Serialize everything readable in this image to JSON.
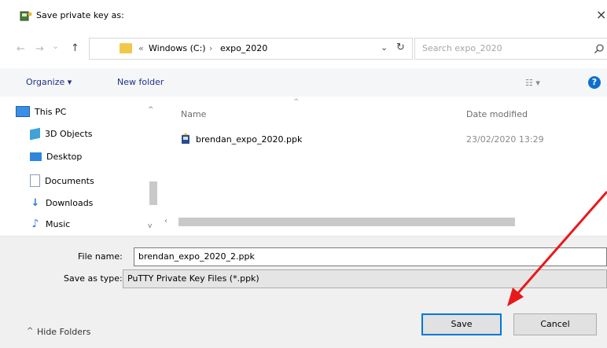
{
  "window": {
    "title": "Save private key as:",
    "close_glyph": "×"
  },
  "nav": {
    "back": "←",
    "forward": "→",
    "recent": "⌄",
    "up": "↑"
  },
  "address": {
    "prefix": "«",
    "segments": [
      "Windows (C:)",
      "expo_2020"
    ],
    "separator": "›"
  },
  "search": {
    "placeholder": "Search expo_2020"
  },
  "toolbar": {
    "organize": "Organize ▾",
    "new_folder": "New folder",
    "help": "?"
  },
  "sidebar": {
    "items": [
      {
        "label": "This PC",
        "icon": "this-pc-icon"
      },
      {
        "label": "3D Objects",
        "icon": "3d-objects-icon"
      },
      {
        "label": "Desktop",
        "icon": "desktop-icon"
      },
      {
        "label": "Documents",
        "icon": "documents-icon"
      },
      {
        "label": "Downloads",
        "icon": "downloads-icon"
      },
      {
        "label": "Music",
        "icon": "music-icon"
      }
    ]
  },
  "filelist": {
    "columns": {
      "name": "Name",
      "date": "Date modified"
    },
    "rows": [
      {
        "name": "brendan_expo_2020.ppk",
        "date": "23/02/2020 13:29"
      }
    ]
  },
  "form": {
    "file_name_label": "File name:",
    "file_name_value": "brendan_expo_2020_2.ppk",
    "save_type_label": "Save as type:",
    "save_type_value": "PuTTY Private Key Files (*.ppk)"
  },
  "footer": {
    "hide_folders": "Hide Folders",
    "save": "Save",
    "cancel": "Cancel"
  },
  "colors": {
    "accent": "#0078d7",
    "annotation_arrow": "#e8191b"
  }
}
